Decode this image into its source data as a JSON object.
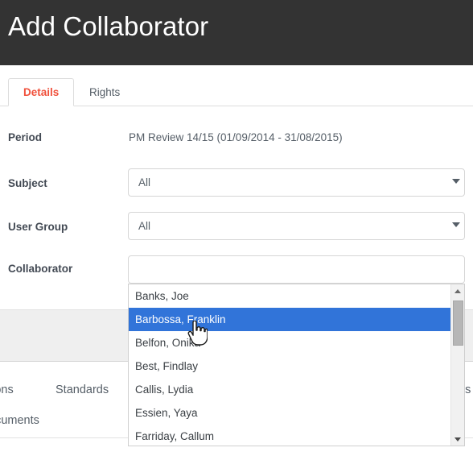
{
  "background": {
    "links": [
      {
        "label": "ations"
      },
      {
        "label": "Standards"
      },
      {
        "label": "ocuments"
      },
      {
        "label": "es"
      }
    ]
  },
  "modal": {
    "title": "Add Collaborator",
    "header_bg": "#333333",
    "tabs": [
      {
        "id": "details",
        "label": "Details",
        "active": true,
        "active_color": "#f0513c"
      },
      {
        "id": "rights",
        "label": "Rights",
        "active": false
      }
    ],
    "form": {
      "period": {
        "label": "Period",
        "value": "PM Review 14/15 (01/09/2014 - 31/08/2015)"
      },
      "subject": {
        "label": "Subject",
        "value": "All",
        "options": [
          "All"
        ]
      },
      "user_group": {
        "label": "User Group",
        "value": "All",
        "options": [
          "All"
        ]
      },
      "collaborator": {
        "label": "Collaborator",
        "value": "",
        "placeholder": ""
      }
    },
    "dropdown": {
      "highlight_color": "#3174d9",
      "selected_index": 1,
      "items": [
        {
          "label": "Banks, Joe"
        },
        {
          "label": "Barbossa, Franklin"
        },
        {
          "label": "Belfon, Onika"
        },
        {
          "label": "Best, Findlay"
        },
        {
          "label": "Callis, Lydia"
        },
        {
          "label": "Essien, Yaya"
        },
        {
          "label": "Farriday, Callum"
        }
      ]
    }
  }
}
